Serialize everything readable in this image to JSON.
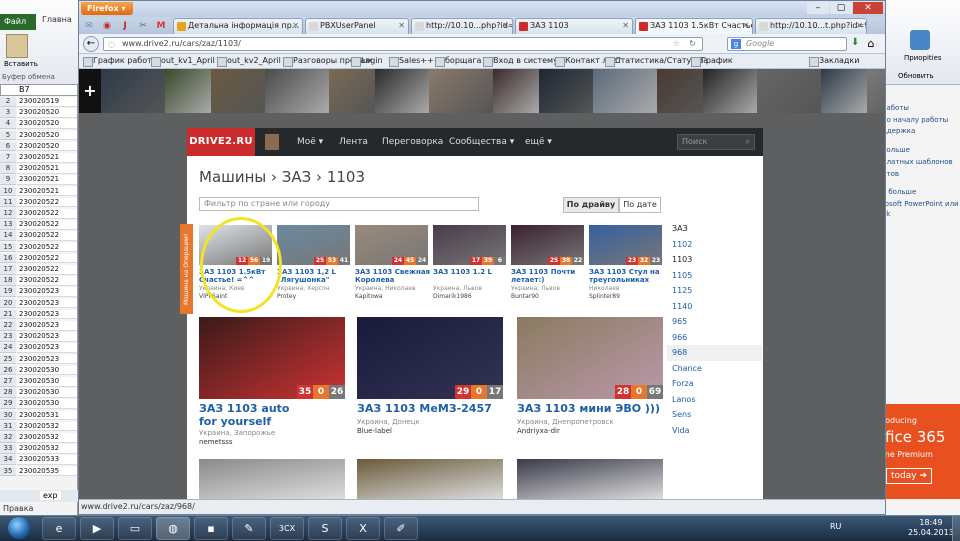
{
  "excel": {
    "tab_file": "Файл",
    "tab_home": "Главна",
    "paste_label": "Вставить",
    "clipboard_label": "Буфер обмена",
    "cell_ref": "B7",
    "rows": [
      {
        "n": "2",
        "v": "230020519"
      },
      {
        "n": "3",
        "v": "230020520"
      },
      {
        "n": "4",
        "v": "230020520"
      },
      {
        "n": "5",
        "v": "230020520"
      },
      {
        "n": "6",
        "v": "230020520"
      },
      {
        "n": "7",
        "v": "230020521"
      },
      {
        "n": "8",
        "v": "230020521"
      },
      {
        "n": "9",
        "v": "230020521"
      },
      {
        "n": "10",
        "v": "230020521"
      },
      {
        "n": "11",
        "v": "230020522"
      },
      {
        "n": "12",
        "v": "230020522"
      },
      {
        "n": "13",
        "v": "230020522"
      },
      {
        "n": "14",
        "v": "230020522"
      },
      {
        "n": "15",
        "v": "230020522"
      },
      {
        "n": "16",
        "v": "230020522"
      },
      {
        "n": "17",
        "v": "230020522"
      },
      {
        "n": "18",
        "v": "230020522"
      },
      {
        "n": "19",
        "v": "230020523"
      },
      {
        "n": "20",
        "v": "230020523"
      },
      {
        "n": "21",
        "v": "230020523"
      },
      {
        "n": "22",
        "v": "230020523"
      },
      {
        "n": "23",
        "v": "230020523"
      },
      {
        "n": "24",
        "v": "230020523"
      },
      {
        "n": "25",
        "v": "230020523"
      },
      {
        "n": "26",
        "v": "230020530"
      },
      {
        "n": "27",
        "v": "230020530"
      },
      {
        "n": "28",
        "v": "230020530"
      },
      {
        "n": "29",
        "v": "230020530"
      },
      {
        "n": "30",
        "v": "230020531"
      },
      {
        "n": "31",
        "v": "230020532"
      },
      {
        "n": "32",
        "v": "230020532"
      },
      {
        "n": "33",
        "v": "230020532"
      },
      {
        "n": "34",
        "v": "230020533"
      },
      {
        "n": "35",
        "v": "230020535"
      }
    ],
    "sheet_tab": "exp",
    "status": "Правка"
  },
  "office": {
    "priorities_label": "Приорities",
    "update_label": "Обновить",
    "links": [
      "работы",
      "по началу работы",
      "ддержка",
      "больше",
      "платных шаблонов",
      "нтов",
      "ь больше",
      "rosoft PowerPoint или",
      "ok"
    ],
    "ad_line1": "roducing",
    "ad_line2": "ffice 365",
    "ad_line3": "me Premium",
    "ad_button": "today ➔"
  },
  "firefox": {
    "menu_label": "Firefox",
    "tabs": [
      {
        "label": "Детальна інформація пр...",
        "color": "#e8a21c"
      },
      {
        "label": "PBXUserPanel",
        "color": "#d8d8d8"
      },
      {
        "label": "http://10.10...php?id=17104",
        "color": "#d8d8d8"
      },
      {
        "label": "ЗАЗ 1103",
        "color": "#cb2b2b"
      },
      {
        "label": "ЗАЗ 1103 1.5кВт Счастье!...",
        "color": "#cb2b2b"
      },
      {
        "label": "http://10.10...t.php?id=987",
        "color": "#d8d8d8"
      }
    ],
    "url": "www.drive2.ru/cars/zaz/1103/",
    "search_placeholder": "Google",
    "bookmarks": [
      "График работы",
      "out_kv1_April",
      "out_kv2_April",
      "Разговоры продаж",
      "Login",
      "Sales+++",
      "борщага",
      "Вход в систему",
      "Контакт лист",
      "Статистика/Статус За",
      "График"
    ],
    "bookmarks_right": "Закладки",
    "status_url": "www.drive2.ru/cars/zaz/968/"
  },
  "drive2": {
    "logo": "DRIVE2.RU",
    "nav": [
      "Моё ▾",
      "Лента",
      "Переговорка",
      "Сообщества ▾",
      "ещё ▾"
    ],
    "search_placeholder": "Поиск",
    "breadcrumb": "Машины › ЗАЗ › 1103",
    "filter_placeholder": "Фильтр по стране или городу",
    "sort_by_drive": "По драйву",
    "sort_by_date": "По дате",
    "vertical_tab": "Машина на Операции!",
    "small_cars": [
      {
        "title": "ЗАЗ 1103 1.5кВт Счастье! =^^",
        "loc": "Украина, Киев",
        "user": "VIPIISaint",
        "b": [
          "12",
          "56",
          "19"
        ]
      },
      {
        "title": "ЗАЗ 1103 1,2 L \"Лягушонка\"",
        "loc": "Украина, Херсон",
        "user": "Protey",
        "b": [
          "25",
          "53",
          "41"
        ]
      },
      {
        "title": "ЗАЗ 1103 Свежная Королева",
        "loc": "Украина, Николаев",
        "user": "Kapitowa",
        "b": [
          "24",
          "45",
          "24"
        ]
      },
      {
        "title": "ЗАЗ 1103 1.2 L",
        "loc": "Украина, Львов",
        "user": "Dimarik1986",
        "b": [
          "17",
          "39",
          "6"
        ]
      },
      {
        "title": "ЗАЗ 1103 Почти летает:)",
        "loc": "Украина, Львов",
        "user": "Buntar90",
        "b": [
          "25",
          "38",
          "22"
        ]
      },
      {
        "title": "ЗАЗ 1103 Стул на треугольниках",
        "loc": "Николаев",
        "user": "Splinter89",
        "b": [
          "23",
          "32",
          "23"
        ]
      }
    ],
    "big_cars": [
      {
        "title": "ЗАЗ 1103 auto for yourself",
        "loc": "Украина, Запорожье",
        "user": "nemetsss",
        "b": [
          "35",
          "0",
          "26"
        ]
      },
      {
        "title": "ЗАЗ 1103 МеМЗ-2457",
        "loc": "Украина, Донецк",
        "user": "Blue-label",
        "b": [
          "29",
          "0",
          "17"
        ]
      },
      {
        "title": "ЗАЗ 1103 мини ЭВО )))",
        "loc": "Украина, Днепропетровск",
        "user": "Andriyxa-dir",
        "b": [
          "28",
          "0",
          "69"
        ]
      }
    ],
    "sidebar": [
      "ЗАЗ",
      "1102",
      "1103",
      "1105",
      "1125",
      "1140",
      "965",
      "966",
      "968",
      "Chance",
      "Forza",
      "Lanos",
      "Sens",
      "Vida"
    ]
  },
  "taskbar": {
    "lang": "RU",
    "time": "18:49",
    "date": "25.04.2013"
  }
}
